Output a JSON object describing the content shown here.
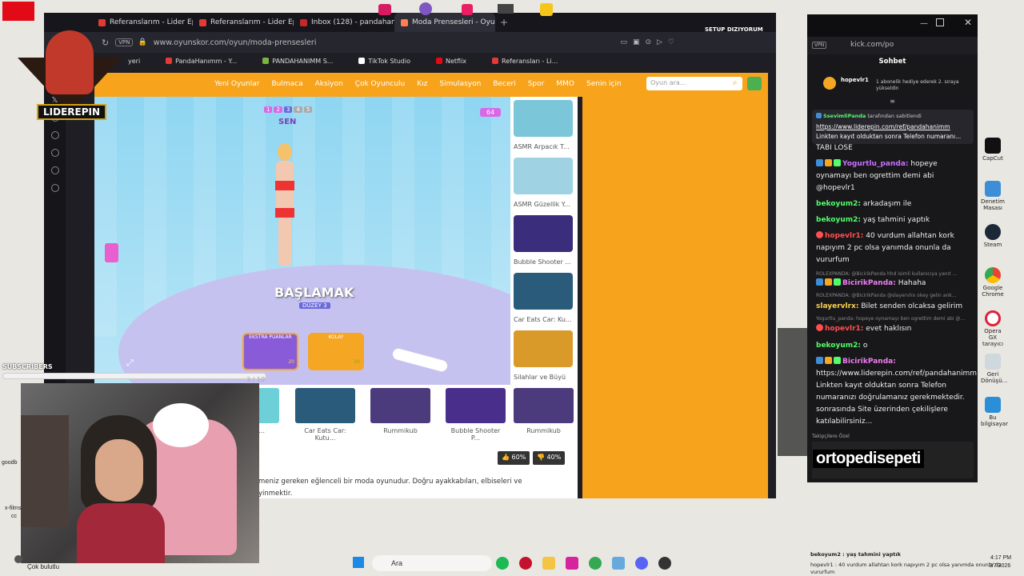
{
  "browser": {
    "tabs": [
      {
        "label": "Referanslarım - Lider Epin",
        "color": "#e53935"
      },
      {
        "label": "Referanslarım - Lider Epin",
        "color": "#e53935"
      },
      {
        "label": "Inbox (128) - pandahanim",
        "color": "#c62828"
      },
      {
        "label": "Moda Prensesleri - Oyuns",
        "color": "#ff7f50"
      }
    ],
    "url": "www.oyunskor.com/oyun/moda-prensesleri",
    "vpn_label": "VPN",
    "bookmarks": [
      {
        "label": "yeri",
        "color": "#888"
      },
      {
        "label": "PandaHanımm - Y...",
        "color": "#e53935"
      },
      {
        "label": "PANDAHANIMM S...",
        "color": "#7cb342"
      },
      {
        "label": "TikTok Studio",
        "color": "#222"
      },
      {
        "label": "Netflix",
        "color": "#e50914"
      },
      {
        "label": "Referansları - Li...",
        "color": "#e53935"
      }
    ]
  },
  "site": {
    "nav": [
      "Yeni Oyunlar",
      "Bulmaca",
      "Aksiyon",
      "Çok Oyunculu",
      "Kız",
      "Simulasyon",
      "Beceri",
      "Spor",
      "MMO",
      "Senin için"
    ],
    "search_placeholder": "Oyun ara...",
    "side_games": [
      {
        "label": "ASMR Arpacık T...",
        "color": "#7bc6d9"
      },
      {
        "label": "ASMR Güzellik Y...",
        "color": "#9fd3e3"
      },
      {
        "label": "Bubble Shooter ...",
        "color": "#3a2e7c"
      },
      {
        "label": "Car Eats Car: Ku...",
        "color": "#2a5b7a"
      },
      {
        "label": "Silahlar ve Büyü",
        "color": "#d99a29"
      }
    ],
    "bottom_games": [
      {
        "label": "oard ...",
        "color": "#6dcfd8"
      },
      {
        "label": "Car Eats Car: Kutu...",
        "color": "#2a5b7a"
      },
      {
        "label": "Rummikub",
        "color": "#4b3a7c"
      },
      {
        "label": "Bubble Shooter P...",
        "color": "#4a2e8c"
      },
      {
        "label": "Rummikub",
        "color": "#4b3a7c"
      }
    ],
    "like": "60%",
    "dislike": "40%",
    "desc_1": "meniz gereken eğlenceli bir moda oyunudur. Doğru ayakkabıları, elbiseleri ve",
    "desc_2": "yinmektir."
  },
  "game": {
    "level_steps": [
      "1",
      "2",
      "3",
      "4",
      "5"
    ],
    "player_tag": "SEN",
    "coins": "64",
    "start": "BAŞLAMAK",
    "level": "DÜZEY 3",
    "progress": "3 / 10",
    "card1": "EKSTRA PUANLAR",
    "card2": "KOLAY",
    "card1_val": "20",
    "card2_val": "20"
  },
  "overlay": {
    "brand": "LIDEREPIN",
    "setup": "SETUP DIZIYORUM",
    "subscribers_label": "SUBSCRIBERS",
    "cok_bulutlu": "Çok bulutlu",
    "ortopedi": "ortopedisepeti",
    "follower_label": "Takipçilere Özel"
  },
  "chat": {
    "url": "kick.com/po",
    "title": "Sohbet",
    "top_user": "hopevlr1",
    "top_text": "1 abonelik hediye ederek 2. sıraya yükseldin",
    "pin_user": "SsevimliPanda",
    "pin_suffix": "tarafından sabitlendi",
    "pin_link": "https://www.liderepin.com/ref/pandahanimm",
    "pin_text": "Linkten kayıt olduktan sonra Telefon numaranı...",
    "messages": [
      {
        "user": "",
        "text": "TABI LOSE",
        "color": "#efeff1"
      },
      {
        "user": "Yogurtlu_panda:",
        "text": "hopeye oynamayı ben ogrettim demi abi @hopevlr1",
        "color": "#c970ff"
      },
      {
        "user": "bekoyum2:",
        "text": "arkadaşım ile",
        "color": "#53fc6a"
      },
      {
        "user": "bekoyum2:",
        "text": "yaş tahmini yaptık",
        "color": "#53fc6a"
      },
      {
        "user": "hopevlr1:",
        "text": "40 vurdum allahtan kork napıyım 2 pc olsa yanımda onunla da vururfum",
        "color": "#ff4f4f"
      },
      {
        "user": "BicirikPanda:",
        "text": "Hahaha",
        "color": "#f07ef2"
      },
      {
        "user": "slayervlrx:",
        "text": "Bilet senden olcaksa gelirim",
        "color": "#ffd24a"
      },
      {
        "user": "hopevlr1:",
        "text": "evet haklısın",
        "color": "#ff4f4f"
      },
      {
        "user": "bekoyum2:",
        "text": "o",
        "color": "#53fc6a"
      },
      {
        "user": "BicirikPanda:",
        "text": "https://www.liderepin.com/ref/pandahanimm Linkten kayıt olduktan sonra Telefon numaranızı doğrulamanız gerekmektedir. sonrasında Site üzerinden çekilişlere katılabilirsiniz...",
        "color": "#f07ef2"
      }
    ],
    "sys_1": "ROLEXPANDA: @BicirikPanda hhd isimli kullanıcıya yanıt ...",
    "sys_2": "ROLEXPANDA: @BicirikPanda @slayervlrx okey gelin ank...",
    "sys_3": "Yogurtlu_panda: hopeye oynamayı ben ogrettim demi abi @..."
  },
  "overlay_chat": [
    "bekoyum2 : yaş tahmini yaptık",
    "hopevlr1 : 40 vurdum allahtan kork napıyım 2 pc olsa yanımda onunla da vururfum"
  ],
  "desktop_icons": [
    "CapCut",
    "Denetim Masası",
    "Steam",
    "Google Chrome",
    "Opera GX tarayıcı",
    "Geri Dönüşü...",
    "Bu bilgisayar"
  ],
  "taskbar": {
    "search": "Ara",
    "time": "4:17 PM",
    "date": "3/7/2026"
  },
  "left_labels": [
    "goodb",
    "x-films",
    "cc"
  ]
}
